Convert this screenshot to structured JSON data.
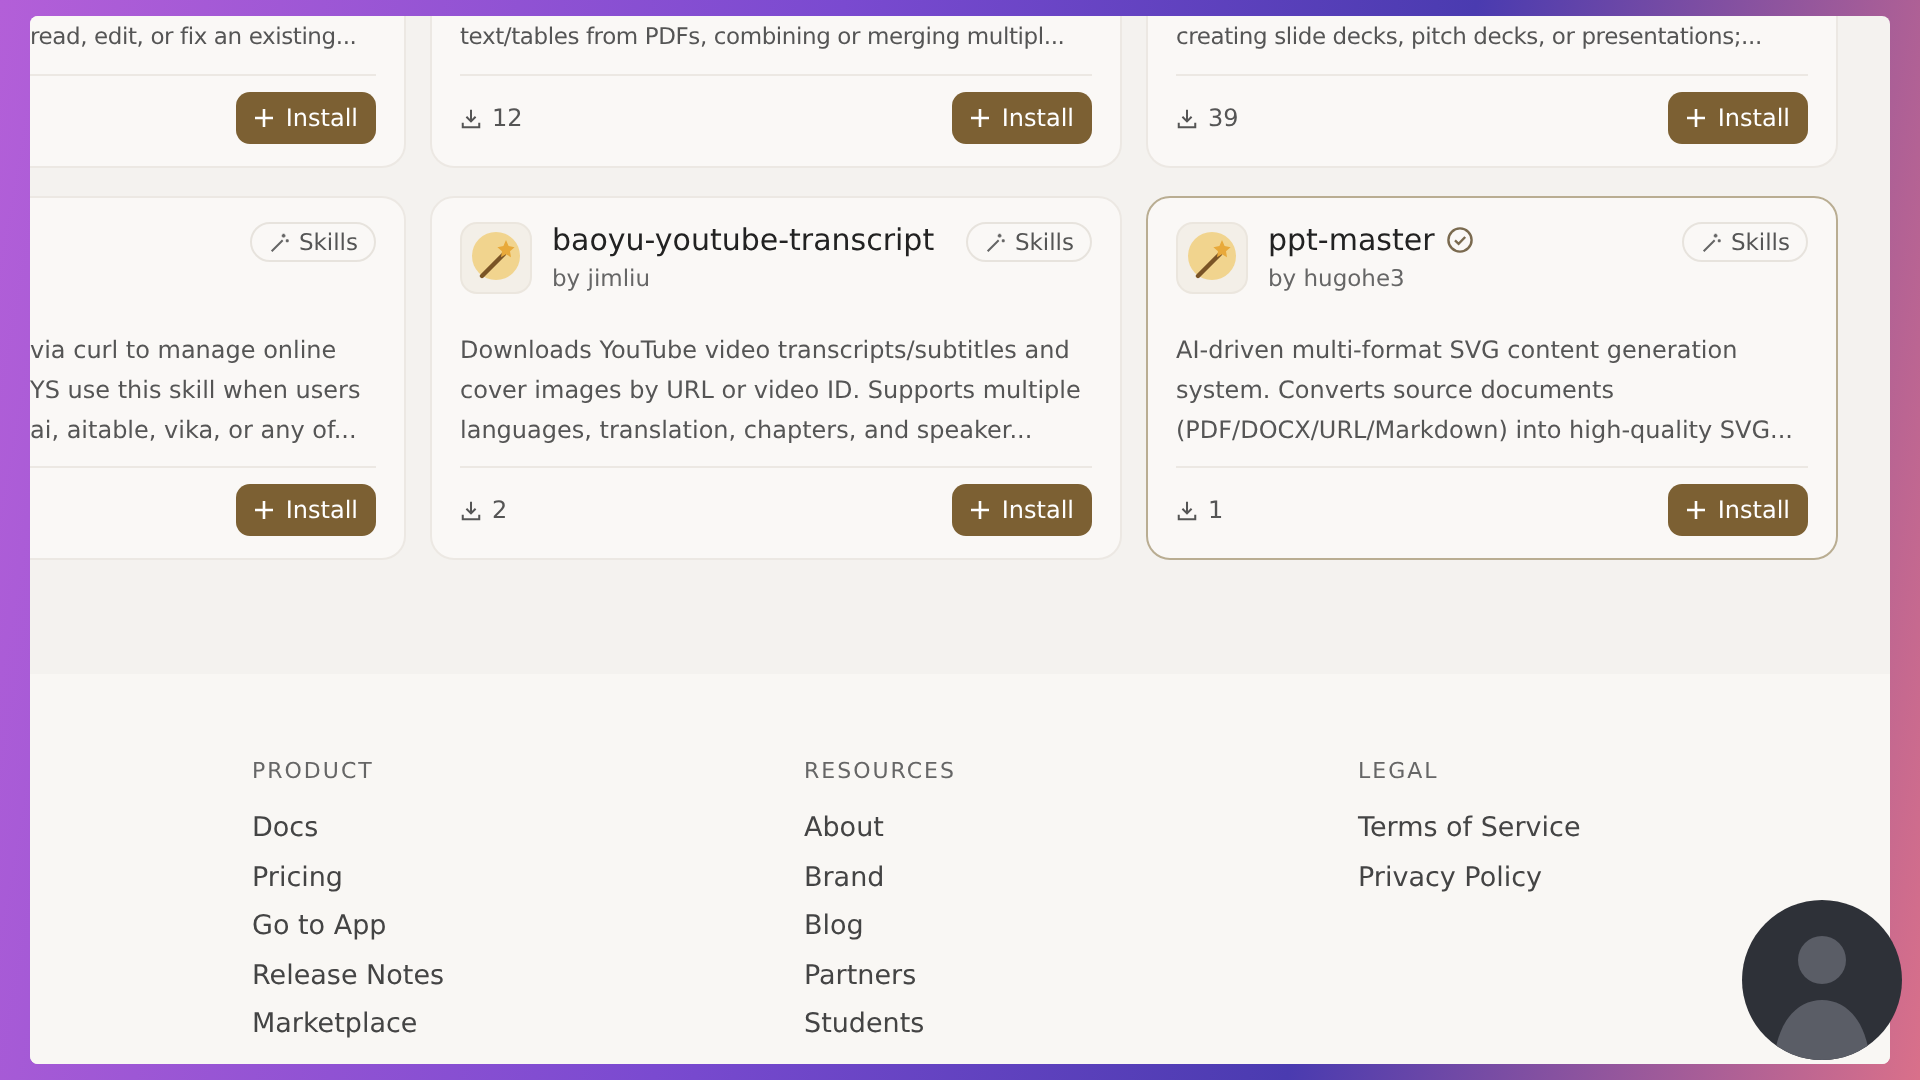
{
  "skill_cards_row_1": [
    {
      "description_tail": "read, edit, or fix an existing...",
      "install_label": "Install"
    },
    {
      "description_tail": "text/tables from PDFs, combining or merging multipl...",
      "downloads": "12",
      "install_label": "Install"
    },
    {
      "description_tail": "creating slide decks, pitch decks, or presentations;...",
      "downloads": "39",
      "install_label": "Install"
    }
  ],
  "skill_cards_row_2": [
    {
      "kind": "clipped",
      "category": "Skills",
      "description_lines": [
        "via curl to manage online",
        "YS use this skill when users",
        "ai, aitable, vika, or any of..."
      ],
      "install_label": "Install"
    },
    {
      "kind": "full",
      "title": "baoyu-youtube-transcript",
      "verified": false,
      "highlighted": false,
      "author": "by jimliu",
      "category": "Skills",
      "description": "Downloads YouTube video transcripts/subtitles and cover images by URL or video ID. Supports multiple languages, translation, chapters, and speaker...",
      "downloads": "2",
      "install_label": "Install"
    },
    {
      "kind": "full",
      "title": "ppt-master",
      "verified": true,
      "highlighted": true,
      "author": "by hugohe3",
      "category": "Skills",
      "description": "AI-driven multi-format SVG content generation system. Converts source documents (PDF/DOCX/URL/Markdown) into high-quality SVG...",
      "downloads": "1",
      "install_label": "Install"
    }
  ],
  "footer": {
    "columns": [
      {
        "heading": "PRODUCT",
        "links": [
          "Docs",
          "Pricing",
          "Go to App",
          "Release Notes",
          "Marketplace"
        ]
      },
      {
        "heading": "RESOURCES",
        "links": [
          "About",
          "Brand",
          "Blog",
          "Partners",
          "Students"
        ]
      },
      {
        "heading": "LEGAL",
        "links": [
          "Terms of Service",
          "Privacy Policy"
        ]
      }
    ]
  }
}
